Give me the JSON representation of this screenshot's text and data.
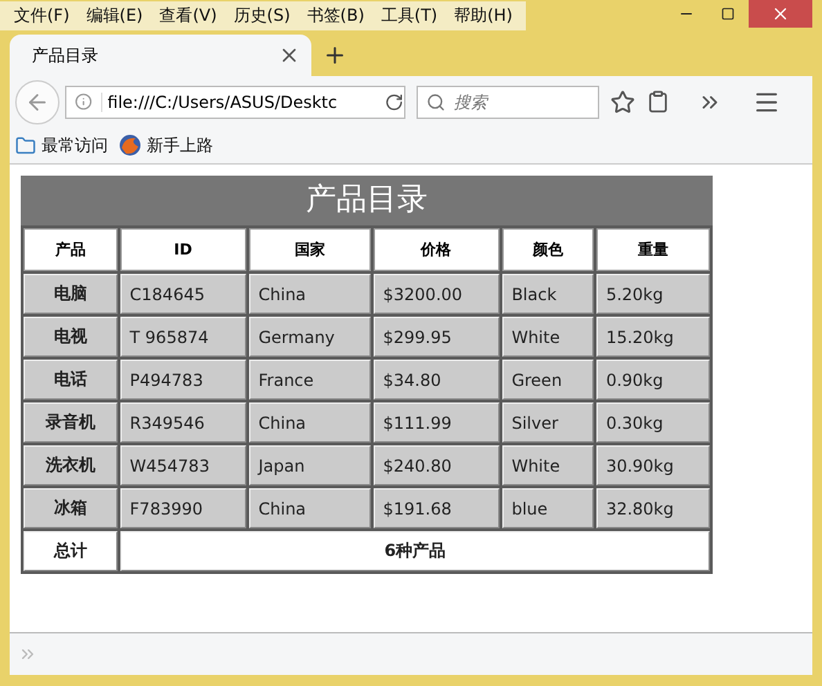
{
  "menu": [
    "文件(F)",
    "编辑(E)",
    "查看(V)",
    "历史(S)",
    "书签(B)",
    "工具(T)",
    "帮助(H)"
  ],
  "tabs": [
    {
      "label": "产品目录",
      "selected": true
    }
  ],
  "address": {
    "value": "file:///C:/Users/ASUS/Desktc"
  },
  "search": {
    "placeholder": "搜索"
  },
  "bookmarks": [
    {
      "label": "最常访问",
      "kind": "folder"
    },
    {
      "label": "新手上路",
      "kind": "globe"
    }
  ],
  "table": {
    "caption": "产品目录",
    "columns": [
      "产品",
      "ID",
      "国家",
      "价格",
      "颜色",
      "重量"
    ],
    "rows": [
      [
        "电脑",
        "C184645",
        "China",
        "$3200.00",
        "Black",
        "5.20kg"
      ],
      [
        "电视",
        "T 965874",
        "Germany",
        "$299.95",
        "White",
        "15.20kg"
      ],
      [
        "电话",
        "P494783",
        "France",
        "$34.80",
        "Green",
        "0.90kg"
      ],
      [
        "录音机",
        "R349546",
        "China",
        "$111.99",
        "Silver",
        "0.30kg"
      ],
      [
        "洗衣机",
        "W454783",
        "Japan",
        "$240.80",
        "White",
        "30.90kg"
      ],
      [
        "冰箱",
        "F783990",
        "China",
        "$191.68",
        "blue",
        "32.80kg"
      ]
    ],
    "footer": {
      "label": "总计",
      "value": "6种产品"
    }
  }
}
